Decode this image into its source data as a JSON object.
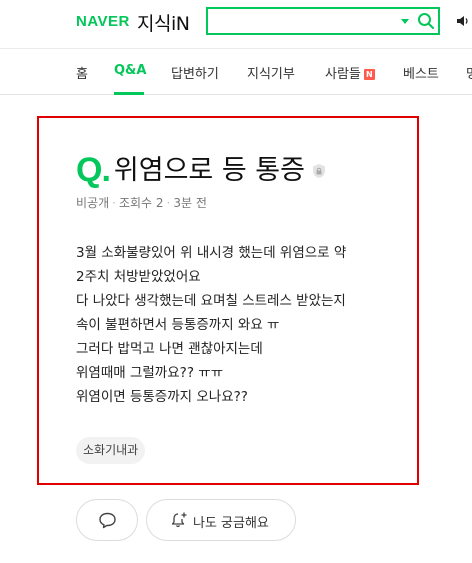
{
  "header": {
    "naver_logo": "NAVER",
    "service_logo": "지식iN",
    "search": {
      "value": "",
      "placeholder": ""
    },
    "accent_color": "#03c75a"
  },
  "nav": {
    "items": [
      {
        "label": "홈",
        "active": false
      },
      {
        "label": "Q&A",
        "active": true
      },
      {
        "label": "답변하기",
        "active": false
      },
      {
        "label": "지식기부",
        "active": false
      },
      {
        "label": "사람들",
        "active": false,
        "badge": "N"
      },
      {
        "label": "베스트",
        "active": false
      },
      {
        "label": "명",
        "active": false
      }
    ]
  },
  "question": {
    "q_mark": "Q.",
    "title": "위염으로 등 통증",
    "meta": {
      "visibility": "비공개",
      "views": "조회수 2",
      "time": "3분 전"
    },
    "body_lines": [
      "3월 소화불량있어 위 내시경 했는데 위염으로 약",
      "2주치 처방받았었어요",
      "다 나았다 생각했는데 요며칠 스트레스 받았는지",
      "속이 불편하면서 등통증까지 와요 ㅠ",
      "그러다 밥먹고 나면 괜찮아지는데",
      "위염때매 그럴까요?? ㅠㅠ",
      "위염이면 등통증까지 오나요??"
    ],
    "tag": "소화기내과",
    "highlight_color": "#e00000"
  },
  "actions": {
    "curious_label": "나도 궁금해요"
  },
  "icons": {
    "dropdown": "caret-down-icon",
    "search": "search-icon",
    "volume": "speaker-icon",
    "lock": "lock-badge-icon",
    "comment": "comment-bubble-icon",
    "bell": "bell-plus-icon"
  }
}
